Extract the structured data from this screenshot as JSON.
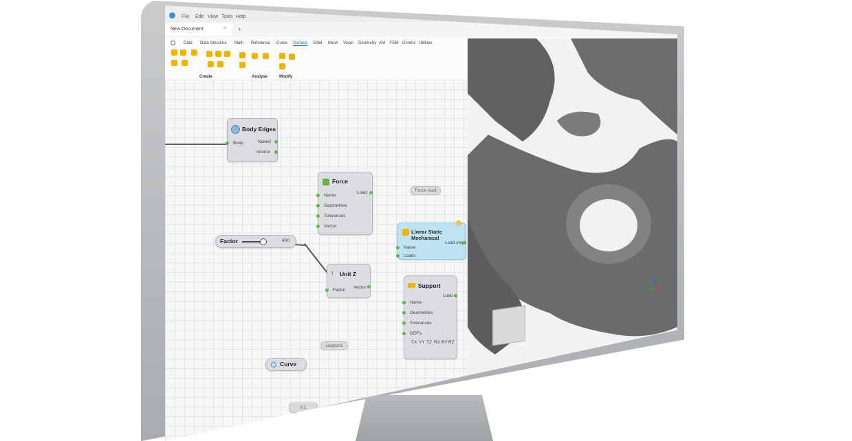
{
  "menu": [
    "File",
    "Edit",
    "View",
    "Tools",
    "Help"
  ],
  "document_tab": {
    "label": "New Document",
    "close": "×",
    "add": "+"
  },
  "ribbon": {
    "tabs": [
      "Data",
      "Data Structure",
      "Math",
      "Reference",
      "Curve",
      "Surface",
      "Solid",
      "Mesh",
      "Voxel",
      "Geometry",
      "AM",
      "FEM",
      "Control",
      "Utilities"
    ],
    "active_tab": "Surface",
    "groups": [
      "Create",
      "Analyse",
      "Modify"
    ]
  },
  "nodes": {
    "body_edges": {
      "title": "Body Edges",
      "inputs": [
        "Body"
      ],
      "outputs": [
        "Naked",
        "Interior"
      ]
    },
    "force": {
      "title": "Force",
      "inputs": [
        "Name",
        "Geometries",
        "Tolerances",
        "Vector"
      ],
      "outputs": [
        "Load"
      ]
    },
    "factor": {
      "title": "Factor",
      "value": "400"
    },
    "unit_z": {
      "title": "Unit Z",
      "inputs": [
        "Factor"
      ],
      "outputs": [
        "Vector"
      ]
    },
    "linear_static": {
      "title": "Linear Static Mechanical",
      "inputs": [
        "Name",
        "Loads"
      ],
      "outputs": [
        "Load step"
      ]
    },
    "support": {
      "title": "Support",
      "inputs": [
        "Name",
        "Geometries",
        "Tolerances",
        "DOFs"
      ],
      "outputs": [
        "Load"
      ],
      "dofs": [
        "TX",
        "YY",
        "TZ",
        "RX",
        "RY",
        "RZ"
      ]
    },
    "curve": {
      "title": "Curve"
    }
  },
  "pills": {
    "force_load": "Force load",
    "support1": "support1",
    "value": "0.1"
  },
  "colors": {
    "accent": "#1f6fb5",
    "port": "#5fb548",
    "highlight_node": "#bfe3f2"
  }
}
